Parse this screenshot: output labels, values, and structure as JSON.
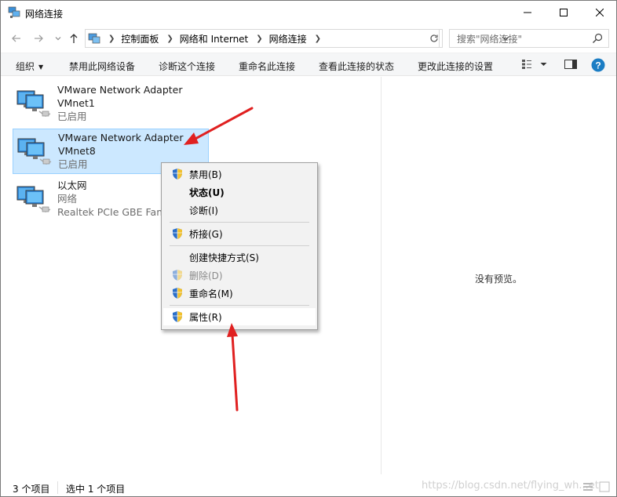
{
  "window": {
    "title": "网络连接"
  },
  "address": {
    "breadcrumbs": [
      "控制面板",
      "网络和 Internet",
      "网络连接"
    ],
    "search_placeholder": "搜索\"网络连接\""
  },
  "toolbar": {
    "organize": "组织",
    "items": [
      "禁用此网络设备",
      "诊断这个连接",
      "重命名此连接",
      "查看此连接的状态",
      "更改此连接的设置"
    ]
  },
  "connections": [
    {
      "name": "VMware Network Adapter",
      "sub": "VMnet1",
      "status": "已启用"
    },
    {
      "name": "VMware Network Adapter",
      "sub": "VMnet8",
      "status": "已启用"
    },
    {
      "name": "以太网",
      "sub": "网络",
      "status": "Realtek PCIe GBE Fami"
    }
  ],
  "context_menu": {
    "items": [
      {
        "label": "禁用(B)",
        "shield": true
      },
      {
        "label": "状态(U)",
        "shield": false,
        "bold": true
      },
      {
        "label": "诊断(I)",
        "shield": false
      },
      {
        "label": "桥接(G)",
        "shield": true
      },
      {
        "label": "创建快捷方式(S)",
        "shield": false
      },
      {
        "label": "删除(D)",
        "shield": true,
        "disabled": true
      },
      {
        "label": "重命名(M)",
        "shield": true
      },
      {
        "label": "属性(R)",
        "shield": true
      }
    ]
  },
  "preview": {
    "text": "没有预览。"
  },
  "status": {
    "count": "3 个项目",
    "selected": "选中 1 个项目",
    "watermark": "https://blog.csdn.net/flying_wh...et"
  },
  "colors": {
    "selection": "#cce8ff",
    "annotation_arrow": "#e02020",
    "help": "#1b7dc4"
  }
}
